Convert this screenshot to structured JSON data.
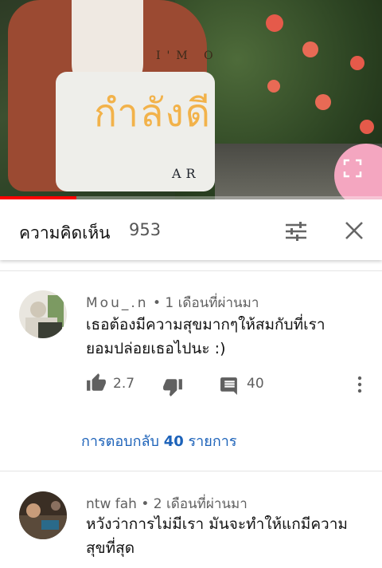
{
  "video": {
    "overlay_top": "I'M O",
    "overlay_title": "กำลังดี",
    "overlay_bottom": "AR",
    "progress_fraction": 0.2
  },
  "comments_header": {
    "title": "ความคิดเห็น",
    "count": "953"
  },
  "comments": [
    {
      "author": "Mou_.n",
      "time": "1 เดือนที่ผ่านมา",
      "text_line1": "เธอต้องมีความสุขมากๆให้สมกับที่เรา",
      "text_line2": "ยอมปล่อยเธอไปนะ :)",
      "likes": "2.7",
      "replies_count": "40",
      "view_replies_prefix": "การตอบกลับ",
      "view_replies_count": "40",
      "view_replies_suffix": "รายการ"
    },
    {
      "author": "ntw fah",
      "time": "2 เดือนที่ผ่านมา",
      "text_line1": "หวังว่าการไม่มีเรา มันจะทำให้แกมีความ",
      "text_line2": "สุขที่สุด"
    }
  ],
  "colors": {
    "accent_link": "#1c62b9",
    "progress": "#ff0000",
    "overlay_title": "#f2b24a"
  }
}
